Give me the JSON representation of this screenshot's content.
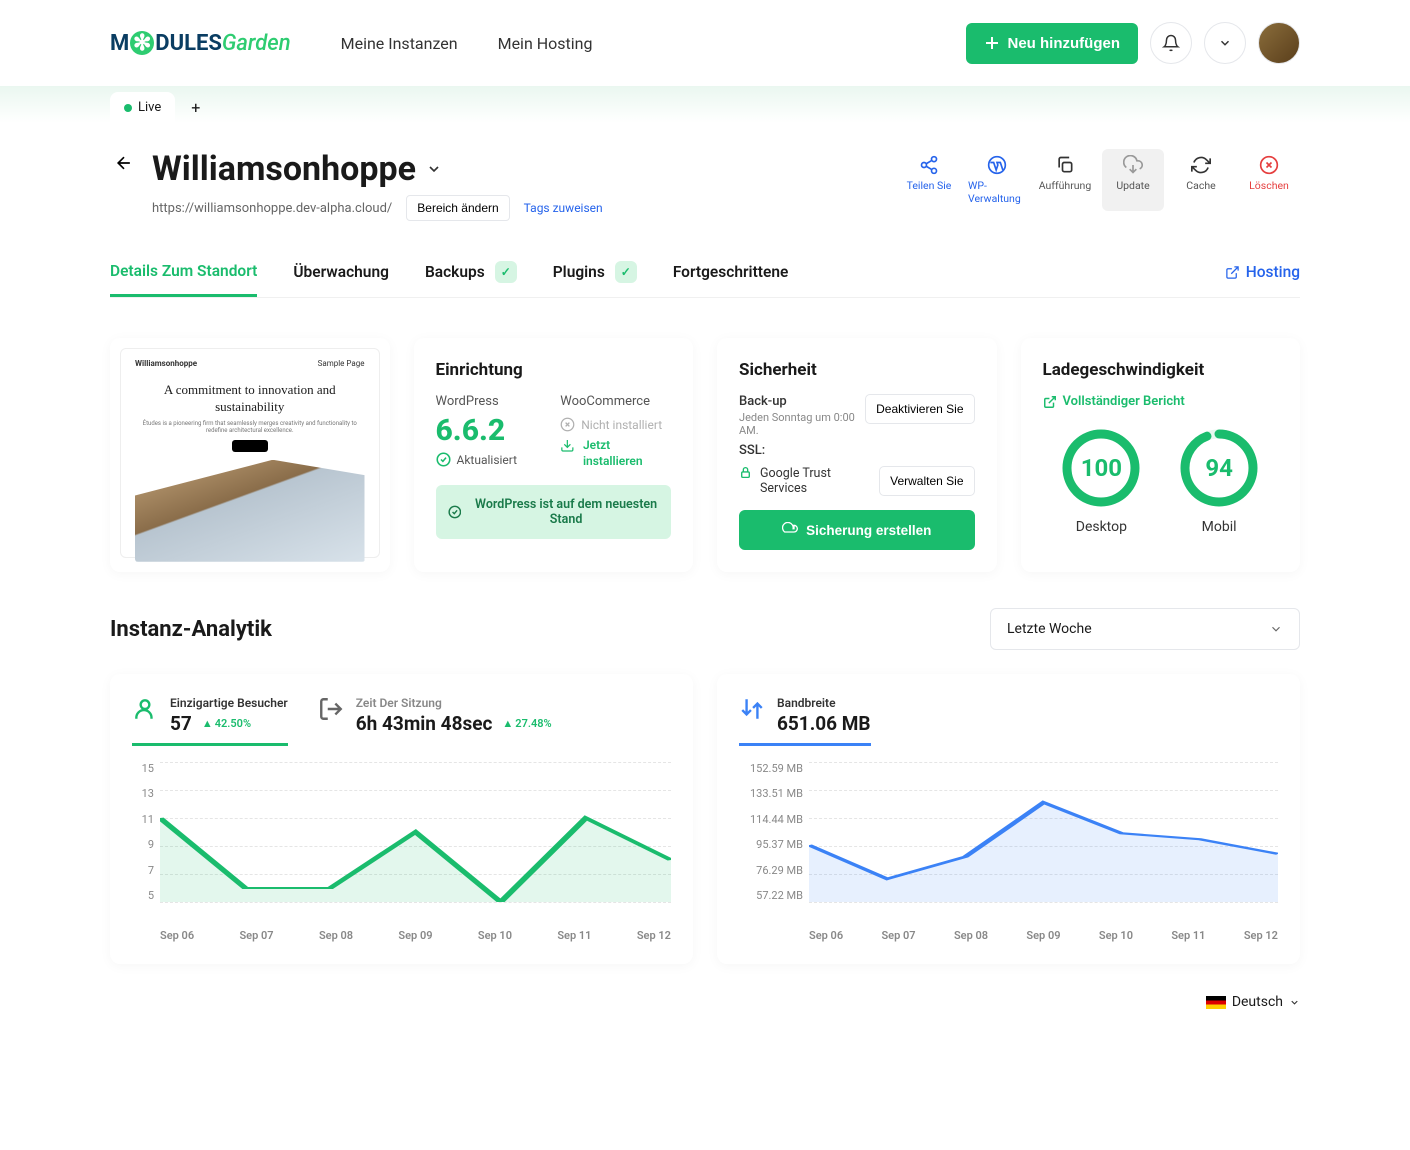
{
  "topnav": {
    "my_instances": "Meine Instanzen",
    "my_hosting": "Mein Hosting",
    "add_new": "Neu hinzufügen"
  },
  "tabs": {
    "live": "Live"
  },
  "site": {
    "name": "Williamsonhoppe",
    "url": "https://williamsonhoppe.dev-alpha.cloud/",
    "change_area": "Bereich ändern",
    "assign_tags": "Tags zuweisen"
  },
  "actions": {
    "share": "Teilen Sie",
    "wp": "WP-Verwaltung",
    "staging": "Aufführung",
    "update": "Update",
    "cache": "Cache",
    "delete": "Löschen"
  },
  "sectionTabs": {
    "details": "Details Zum Standort",
    "monitoring": "Überwachung",
    "backups": "Backups",
    "plugins": "Plugins",
    "advanced": "Fortgeschrittene",
    "hosting": "Hosting"
  },
  "preview": {
    "brand": "Williamsonhoppe",
    "sample": "Sample Page",
    "headline": "A commitment to innovation and sustainability",
    "sub": "Études is a pioneering firm that seamlessly merges creativity and functionality to redefine architectural excellence."
  },
  "setup": {
    "title": "Einrichtung",
    "wp_label": "WordPress",
    "wp_version": "6.6.2",
    "updated": "Aktualisiert",
    "wc_label": "WooCommerce",
    "wc_status": "Nicht installiert",
    "install_now": "Jetzt installieren",
    "banner": "WordPress ist auf dem neuesten Stand"
  },
  "security": {
    "title": "Sicherheit",
    "backup_label": "Back-up",
    "backup_sub": "Jeden Sonntag um 0:00 AM.",
    "deactivate": "Deaktivieren Sie",
    "ssl_label": "SSL:",
    "ssl_provider": "Google Trust Services",
    "manage": "Verwalten Sie",
    "create_backup": "Sicherung erstellen"
  },
  "speed": {
    "title": "Ladegeschwindigkeit",
    "full_report": "Vollständiger Bericht",
    "desktop": "Desktop",
    "desktop_val": "100",
    "mobile": "Mobil",
    "mobile_val": "94"
  },
  "analytics": {
    "title": "Instanz-Analytik",
    "range": "Letzte Woche"
  },
  "metrics": {
    "visitors_label": "Einzigartige Besucher",
    "visitors_val": "57",
    "visitors_delta": "42.50%",
    "session_label": "Zeit Der Sitzung",
    "session_val": "6h 43min 48sec",
    "session_delta": "27.48%",
    "bandwidth_label": "Bandbreite",
    "bandwidth_val": "651.06 MB"
  },
  "chart_data": [
    {
      "type": "line",
      "title": "Einzigartige Besucher",
      "categories": [
        "Sep 06",
        "Sep 07",
        "Sep 08",
        "Sep 09",
        "Sep 10",
        "Sep 11",
        "Sep 12"
      ],
      "y_ticks": [
        5,
        7,
        9,
        11,
        13,
        15
      ],
      "ylim": [
        5,
        15
      ],
      "series": [
        {
          "name": "visitors",
          "color": "#1abc6d",
          "values": [
            11,
            6,
            6,
            10,
            5,
            11,
            8
          ]
        }
      ]
    },
    {
      "type": "line",
      "title": "Bandbreite",
      "categories": [
        "Sep 06",
        "Sep 07",
        "Sep 08",
        "Sep 09",
        "Sep 10",
        "Sep 11",
        "Sep 12"
      ],
      "y_ticks": [
        "57.22 MB",
        "76.29 MB",
        "95.37 MB",
        "114.44 MB",
        "133.51 MB",
        "152.59 MB"
      ],
      "ylim": [
        57.22,
        152.59
      ],
      "series": [
        {
          "name": "bandwidth_mb",
          "color": "#3b82f6",
          "values": [
            96,
            73,
            88,
            125,
            104,
            100,
            90
          ]
        }
      ]
    }
  ],
  "footer": {
    "language": "Deutsch"
  }
}
